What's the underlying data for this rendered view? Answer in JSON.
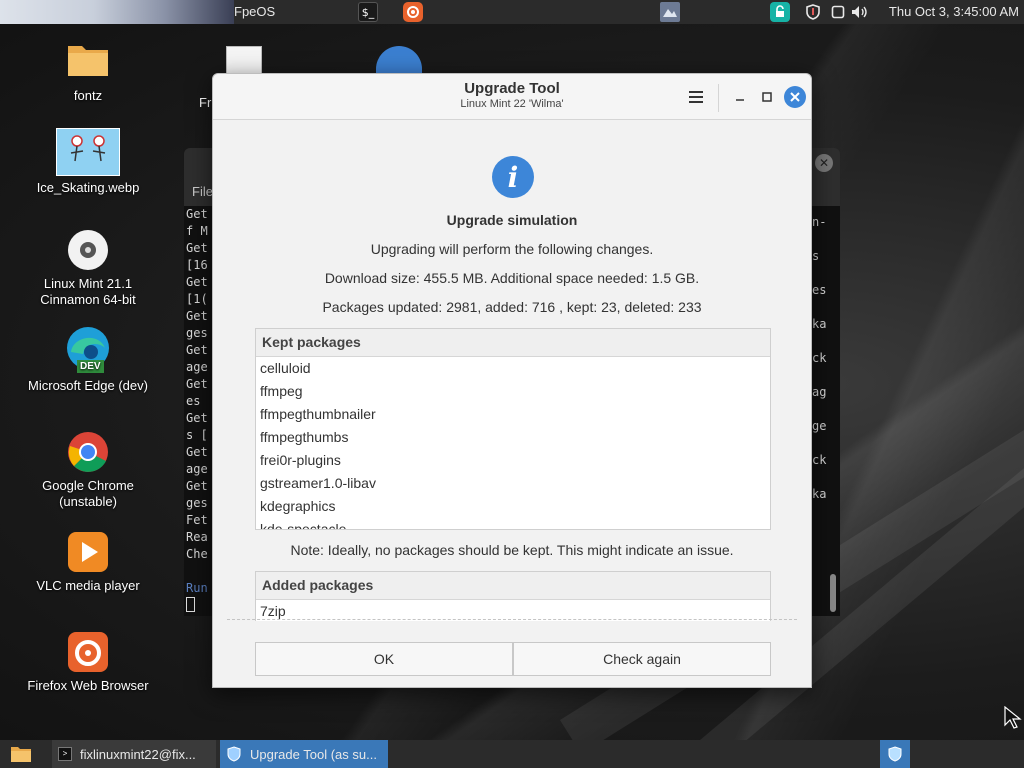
{
  "top_panel": {
    "title": "FpeOS",
    "clock": "Thu Oct  3,  3:45:00 AM"
  },
  "desktop_icons": [
    {
      "label": "fontz"
    },
    {
      "label": "Ice_Skating.webp"
    },
    {
      "label": "Linux Mint 21.1 Cinnamon 64-bit"
    },
    {
      "label": "Microsoft Edge (dev)",
      "badge": "DEV"
    },
    {
      "label": "Google Chrome (unstable)"
    },
    {
      "label": "VLC media player"
    },
    {
      "label": "Firefox Web Browser"
    }
  ],
  "partial_desktop_label": "Fr",
  "terminal": {
    "menu_partial": "File",
    "lines": [
      "Get",
      "f M",
      "Get",
      "[16",
      "Get",
      " [1(",
      "Get",
      "ges",
      "Get",
      "age",
      "Get",
      "es",
      "Get",
      "s [",
      "Get",
      "age",
      "Get",
      "ges",
      "Fet",
      "Rea",
      "Che",
      "",
      "Run"
    ],
    "right_lines": [
      "n-",
      "s",
      "es",
      "ka",
      "ck",
      "ag",
      "ge",
      "ck",
      "ka"
    ]
  },
  "dialog": {
    "title": "Upgrade Tool",
    "subtitle": "Linux Mint 22 'Wilma'",
    "heading": "Upgrade simulation",
    "intro": "Upgrading will perform the following changes.",
    "download": "Download size: 455.5 MB. Additional space needed: 1.5 GB.",
    "packages_summary": "Packages updated: 2981, added: 716 , kept: 23, deleted: 233",
    "kept_header": "Kept packages",
    "kept": [
      "celluloid",
      "ffmpeg",
      "ffmpegthumbnailer",
      "ffmpegthumbs",
      "frei0r-plugins",
      "gstreamer1.0-libav",
      "kdegraphics",
      "kde-spectacle"
    ],
    "note": "Note: Ideally, no packages should be kept. This might indicate an issue.",
    "added_header": "Added packages",
    "added": [
      "7zip"
    ],
    "ok_label": "OK",
    "check_label": "Check again"
  },
  "taskbar": {
    "items": [
      {
        "label": "fixlinuxmint22@fix..."
      },
      {
        "label": "Upgrade Tool (as su..."
      }
    ]
  },
  "colors": {
    "accent": "#3d86d8",
    "taskbar_active": "#3a78b8"
  }
}
